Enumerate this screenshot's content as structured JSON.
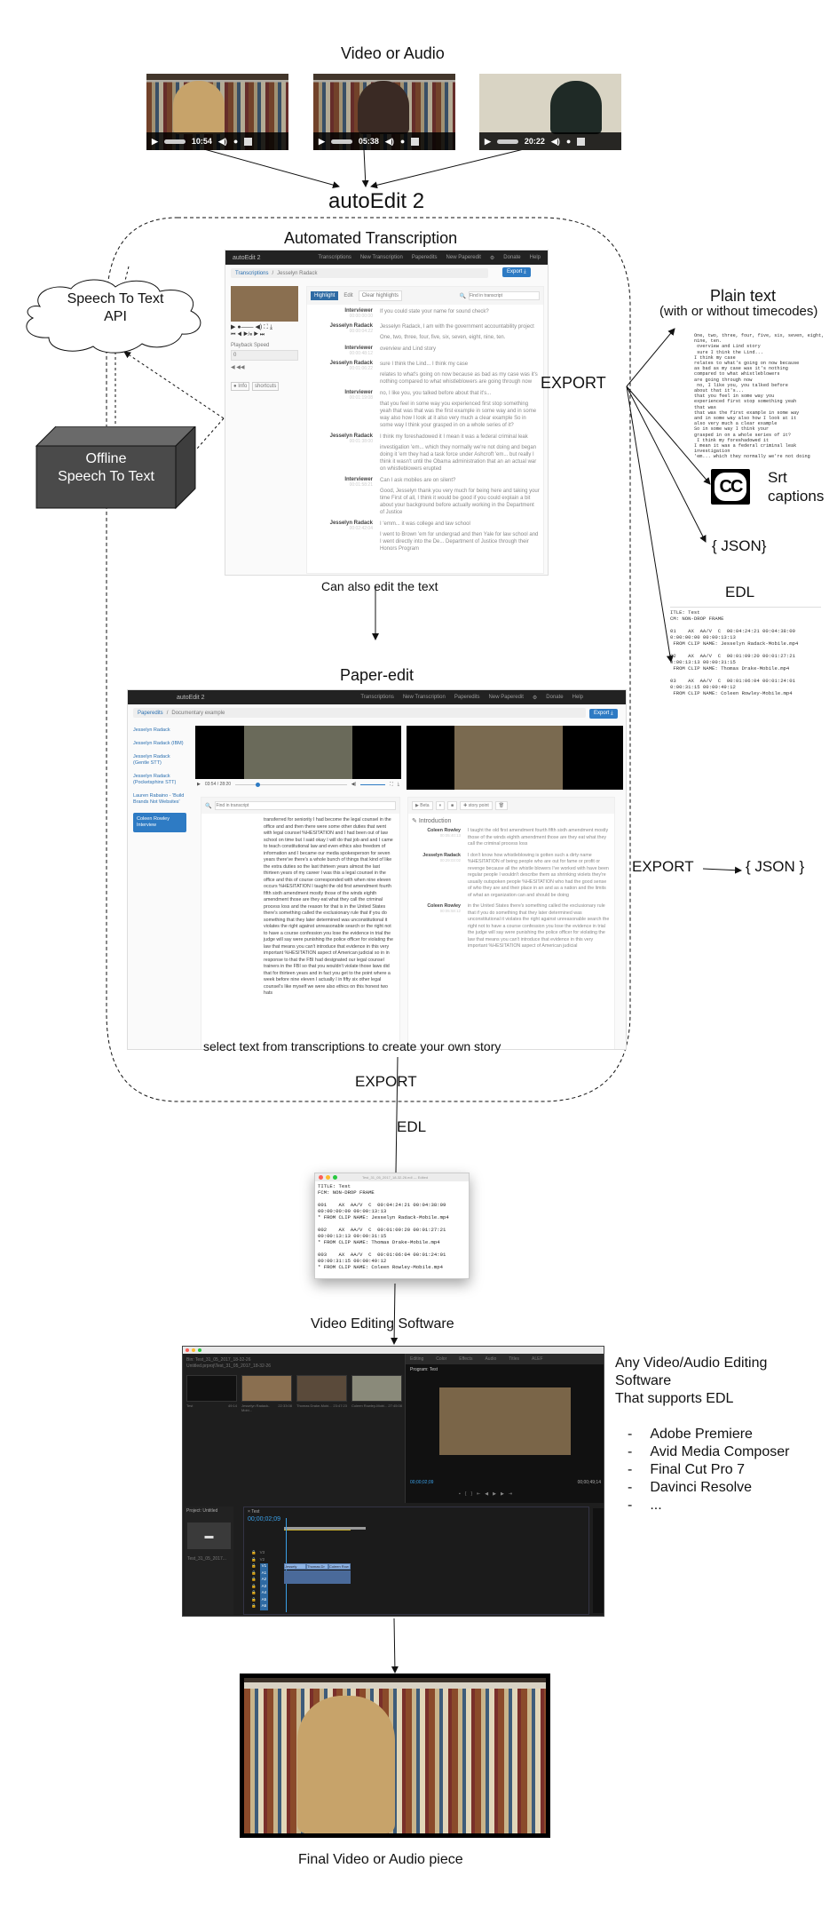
{
  "title_top": "Video or Audio",
  "source_videos": [
    {
      "time": "10:54",
      "subject": "woman with blonde hair in front of bookshelf"
    },
    {
      "time": "05:38",
      "subject": "man in front of bookshelf"
    },
    {
      "time": "20:22",
      "subject": "woman with glasses by window"
    }
  ],
  "app_name": "autoEdit 2",
  "automated_transcription": {
    "heading": "Automated Transcription",
    "nav": {
      "brand": "autoEdit 2",
      "items": [
        "Transcriptions",
        "New Transcription",
        "Paperedits",
        "New Paperedit",
        "Donate",
        "Help"
      ]
    },
    "breadcrumb": {
      "root": "Transcriptions",
      "current": "Jesselyn Radack"
    },
    "export_label": "Export",
    "toolbar": {
      "highlight": "Highlight",
      "edit": "Edit",
      "clear": "Clear highlights",
      "search_placeholder": "Find in transcript"
    },
    "side": {
      "playback_speed": "Playback Speed",
      "speed_value": "0",
      "info": "Info",
      "shortcuts": "shortcuts"
    },
    "lines": [
      {
        "speaker": "Interviewer",
        "tc": "00:00:00:00",
        "text": [
          "If you could state your name for sound check?"
        ]
      },
      {
        "speaker": "Jesselyn Radack",
        "tc": "00:00:04:22",
        "text": [
          "Jesselyn Radack, I am with the government accountability project",
          "One, two, three, four, five, six, seven, eight, nine, ten."
        ]
      },
      {
        "speaker": "Interviewer",
        "tc": "00:00:48:12",
        "text": [
          "overview and Lind story"
        ]
      },
      {
        "speaker": "Jesselyn Radack",
        "tc": "00:01:06:22",
        "text": [
          "sure I think the Lind... I think my case",
          "relates to what's going on now because as bad as my case was it's nothing compared to what whistleblowers are going through now"
        ]
      },
      {
        "speaker": "Interviewer",
        "tc": "00:01:19:08",
        "text": [
          "no, I like you, you talked before about that it's...",
          "that you feel in some way you experienced first stop something yeah that was that was the first example in some way and in some way also how I look at it also very much a clear example So in some way I think your grasped in on a whole series of it?"
        ]
      },
      {
        "speaker": "Jesselyn Radack",
        "tc": "00:01:38:00",
        "text": [
          "I think my foreshadowed it I mean it was a federal criminal leak",
          "investigation 'em... which they normally we're not doing and began doing it 'em they had a task force under Ashcroft 'em... but really I think it wasn't until the Obama administration that an an actual war on whistleblowers erupted"
        ]
      },
      {
        "speaker": "Interviewer",
        "tc": "00:01:58:21",
        "text": [
          "Can I ask mobiles are on silent?",
          "Good, Jesselyn thank you very much for being here and taking your time First of all, I think it would be good if you could explain a bit about your background before actually working in the Department of Justice"
        ]
      },
      {
        "speaker": "Jesselyn Radack",
        "tc": "00:02:42:04",
        "text": [
          "I 'emm... it was college and law school",
          "I went to Brown 'em for undergrad and then Yale for law school and I went directly into the De... Department of Justice through their Honors Program"
        ]
      }
    ],
    "caption": "Can also edit the text"
  },
  "speech_api": {
    "line1": "Speech To Text",
    "line2": "API"
  },
  "offline_stt": {
    "line1": "Offline",
    "line2": "Speech To Text"
  },
  "export_label": "EXPORT",
  "exports": {
    "plain_text": {
      "title": "Plain text",
      "subtitle": "(with or without timecodes)",
      "sample": [
        "One, two, three, four, five, six, seven, eight,",
        "nine, ten.",
        " overview and Lind story",
        " sure I think the Lind...",
        "I think my case",
        "relates to what's going on now because",
        "as bad as my case was it's nothing",
        "compared to what whistleblowers",
        "are going through now",
        " no, I like you, you talked before",
        "about that it's...",
        "that you feel in some way you",
        "experienced first stop something yeah",
        "that was",
        "that was the first example in some way",
        "and in some way also how I look at it",
        "also very much a clear example",
        "So in some way I think your",
        "grasped in on a whole series of it?",
        " I think my foreshadowed it",
        "I mean it was a federal criminal leak",
        "investigation",
        "'em... which they normally we're not doing"
      ]
    },
    "srt": {
      "icon_text": "CC",
      "line1": "Srt",
      "line2": "captions"
    },
    "json": "{ JSON}",
    "edl": {
      "title": "EDL",
      "sample": [
        "ITLE: Test",
        "CM: NON-DROP FRAME",
        "",
        "01    AX  AA/V  C  00:04:24:21 00:04:38:09",
        "0:00:00:00 00:00:13:13",
        " FROM CLIP NAME: Jesselyn Radack-Mobile.mp4",
        "",
        "02    AX  AA/V  C  00:01:09:20 00:01:27:21",
        "0:00:13:13 00:00:31:15",
        " FROM CLIP NAME: Thomas Drake-Mobile.mp4",
        "",
        "03    AX  AA/V  C  00:01:06:04 00:01:24:01",
        "0:00:31:15 00:00:49:12",
        " FROM CLIP NAME: Coleen Rowley-Mobile.mp4"
      ]
    }
  },
  "paper_edit": {
    "heading": "Paper-edit",
    "nav": {
      "brand": "autoEdit 2",
      "items": [
        "Transcriptions",
        "New Transcription",
        "Paperedits",
        "New Paperedit",
        "Donate",
        "Help"
      ]
    },
    "breadcrumb": {
      "root": "Paperedits",
      "current": "Documentary example"
    },
    "export_label": "Export",
    "sidebar": [
      "Jesselyn Radack",
      "Jesselyn Radack (IBM)",
      "Jesselyn Radack (Gentle STT)",
      "Jesselyn Radack (Pocketsphinx STT)",
      "Lauren Rabaino - 'Build Brands Not Websites'",
      "Coleen Rowley Interview"
    ],
    "sidebar_active": 5,
    "player_time": "03:54 / 28:20",
    "search_placeholder": "Find in transcript",
    "transcript": "transferred for seniority I had become the legal counsel in the office and and then there were some other duties that went with legal counsel %HESITATION and I had been out of law school on time but I said okay I will do that job and and I came to teach constitutional law and even ethics also freedom of information and I became our media spokesperson for seven years there've there's a whole bunch of things that kind of like the extra duties so the last thirteen years almost the last thirteen years of my career I was this a legal counsel in the office and this of course corresponded with when nine eleven occurs %HESITATION I taught the old first amendment fourth fifth sixth amendment mostly those of the winds eighth amendment those are they eat what they call the criminal process loss and the reason for that is in the United States there's something called the exclusionary rule that if you do something that they later determined was unconstitutional it violates the right against unreasonable search or the right not to have a course confession you lose the evidence in trial the judge will say were punishing the police officer for violating the law that means you can't introduce that evidence in this very important %HESITATION aspect of American judicial so in in response to that the FBI had designated our legal counsel trainers in the FBI so that you wouldn't violate those laws did that for thirteen years and in fact you get to the point where a week before nine eleven I actually I in fifty six other legal counsel's like myself we were also ethics on this honest two hats",
    "story_toolbar": {
      "play": "Beta",
      "story_point": "story point"
    },
    "story_section": "Introduction",
    "story": [
      {
        "speaker": "Coleen Rowley",
        "tc": "00:05:40:13",
        "text": "I taught the old first amendment fourth fifth sixth amendment mostly those of the winds eighth amendment those are they eat what they call the criminal process loss"
      },
      {
        "speaker": "Jesselyn Radack",
        "tc": "00:29:03:02",
        "text": "I don't know how whistleblowing is gotten such a dirty name %HESITATION of being people who are out for fame or profit or revenge because all the whistle blowers I've worked with have been regular people I wouldn't describe them as shrinking violets they're usually outspoken people %HESITATION who had the good sense of who they are and their place in an and as a nation and the limits of what an organization can and should be doing"
      },
      {
        "speaker": "Coleen Rowley",
        "tc": "00:05:58:12",
        "text": "in the United States there's something called the exclusionary rule that if you do something that they later determined was unconstitutional it violates the right against unreasonable search the right not to have a course confession you lose the evidence in trial the judge will say were punishing the police officer for violating the law that means you can't introduce that evidence in this very important %HESITATION aspect of American judicial"
      }
    ],
    "caption": "select  text from transcriptions to create your own story",
    "json_export": "{ JSON }"
  },
  "edl_export": {
    "label": "EDL",
    "window_title": "Test_31_05_2017_18-32-26.edl — Edited",
    "lines": [
      "TITLE: Test",
      "FCM: NON-DROP FRAME",
      "",
      "001    AX  AA/V  C  00:04:24:21 00:04:38:09",
      "00:00:00:00 00:00:13:13",
      "* FROM CLIP NAME: Jesselyn Radack-Mobile.mp4",
      "",
      "002    AX  AA/V  C  00:01:09:20 00:01:27:21",
      "00:00:13:13 00:00:31:15",
      "* FROM CLIP NAME: Thomas Drake-Mobile.mp4",
      "",
      "003    AX  AA/V  C  00:01:06:04 00:01:24:01",
      "00:00:31:15 00:00:49:12",
      "* FROM CLIP NAME: Coleen Rowley-Mobile.mp4"
    ]
  },
  "video_editing": {
    "heading": "Video Editing Software",
    "bin": "Bin: Test_31_05_2017_18-32-26",
    "project_path": "Untitled.prproj\\Test_31_05_2017_18-32-26",
    "clips": [
      {
        "name": "Test",
        "dur": "49:14"
      },
      {
        "name": "Jesselyn Radack-Mobi...",
        "dur": "22:33:08"
      },
      {
        "name": "Thomas Drake-Mobi...",
        "dur": "23:47:23"
      },
      {
        "name": "Coleen Rowley-Mobi...",
        "dur": "27:45:08"
      }
    ],
    "workspace_tabs": [
      "Editing",
      "Color",
      "Effects",
      "Audio",
      "Titles",
      "ALEF"
    ],
    "program_tab": "Program: Test",
    "program_tc": "00;00;02;09",
    "program_dur": "00;00;49;14",
    "timeline_tab": "Test",
    "timeline_tc": "00;00;02;09",
    "track_clips": [
      "Jessely",
      "Thomas Dr",
      "Coleen Row"
    ],
    "tracks": [
      "V3",
      "V2",
      "V1",
      "A1",
      "A2",
      "A3",
      "A4",
      "A5",
      "A6"
    ],
    "project_panel": "Project: Untitled",
    "project_item": "Test_31_05_2017..."
  },
  "supported_software": {
    "intro": [
      "Any Video/Audio Editing",
      "Software",
      "That supports EDL"
    ],
    "items": [
      "Adobe Premiere",
      "Avid Media Composer",
      "Final Cut Pro 7",
      "Davinci Resolve",
      "..."
    ]
  },
  "final_caption": "Final Video or Audio piece"
}
